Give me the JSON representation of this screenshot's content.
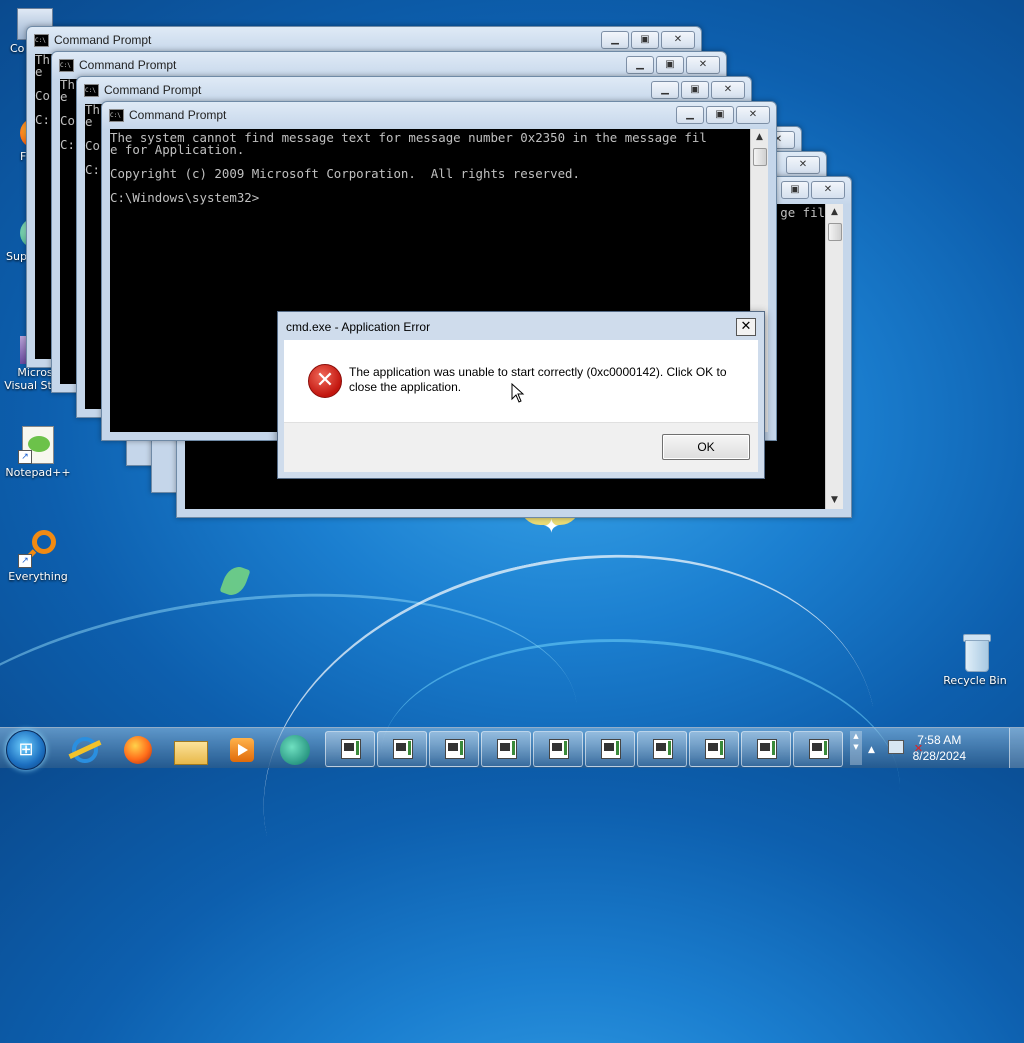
{
  "desktop": {
    "icons": [
      {
        "label": "Co",
        "icon": "computer-icon"
      },
      {
        "label": "F",
        "icon": "firefox-icon"
      },
      {
        "label": "Sup",
        "icon": "support-icon"
      },
      {
        "label": "Micros\nVisual Stud",
        "icon": "visual-studio-icon"
      },
      {
        "label": "Notepad++",
        "icon": "notepad-plus-icon"
      },
      {
        "label": "Everything",
        "icon": "everything-search-icon"
      },
      {
        "label": "Recycle Bin",
        "icon": "recycle-bin-icon"
      }
    ]
  },
  "windows": {
    "title": "Command Prompt",
    "console_text": "The system cannot find message text for message number 0x2350 in the message fil\ne for Application.\n\nCopyright (c) 2009 Microsoft Corporation.  All rights reserved.\n\nC:\\Windows\\system32>",
    "w1_text": "Th\ne\n\nCo\n\nC:",
    "w2_text": "Th\ne\n\nCo\n\nC:",
    "w3_text": "Th\ne\n\nCo\n\nC:",
    "w5_text": "ge fil",
    "w6_text": "ge fil",
    "w7_text": "ge fil"
  },
  "dialog": {
    "title": "cmd.exe - Application Error",
    "message": "The application was unable to start correctly (0xc0000142). Click OK to close the application.",
    "ok_label": "OK",
    "error_symbol": "✕"
  },
  "taskbar": {
    "time": "7:58 AM",
    "date": "8/28/2024",
    "pinned": [
      "internet-explorer-icon",
      "firefox-icon",
      "file-explorer-icon",
      "media-player-icon",
      "app-icon"
    ]
  }
}
